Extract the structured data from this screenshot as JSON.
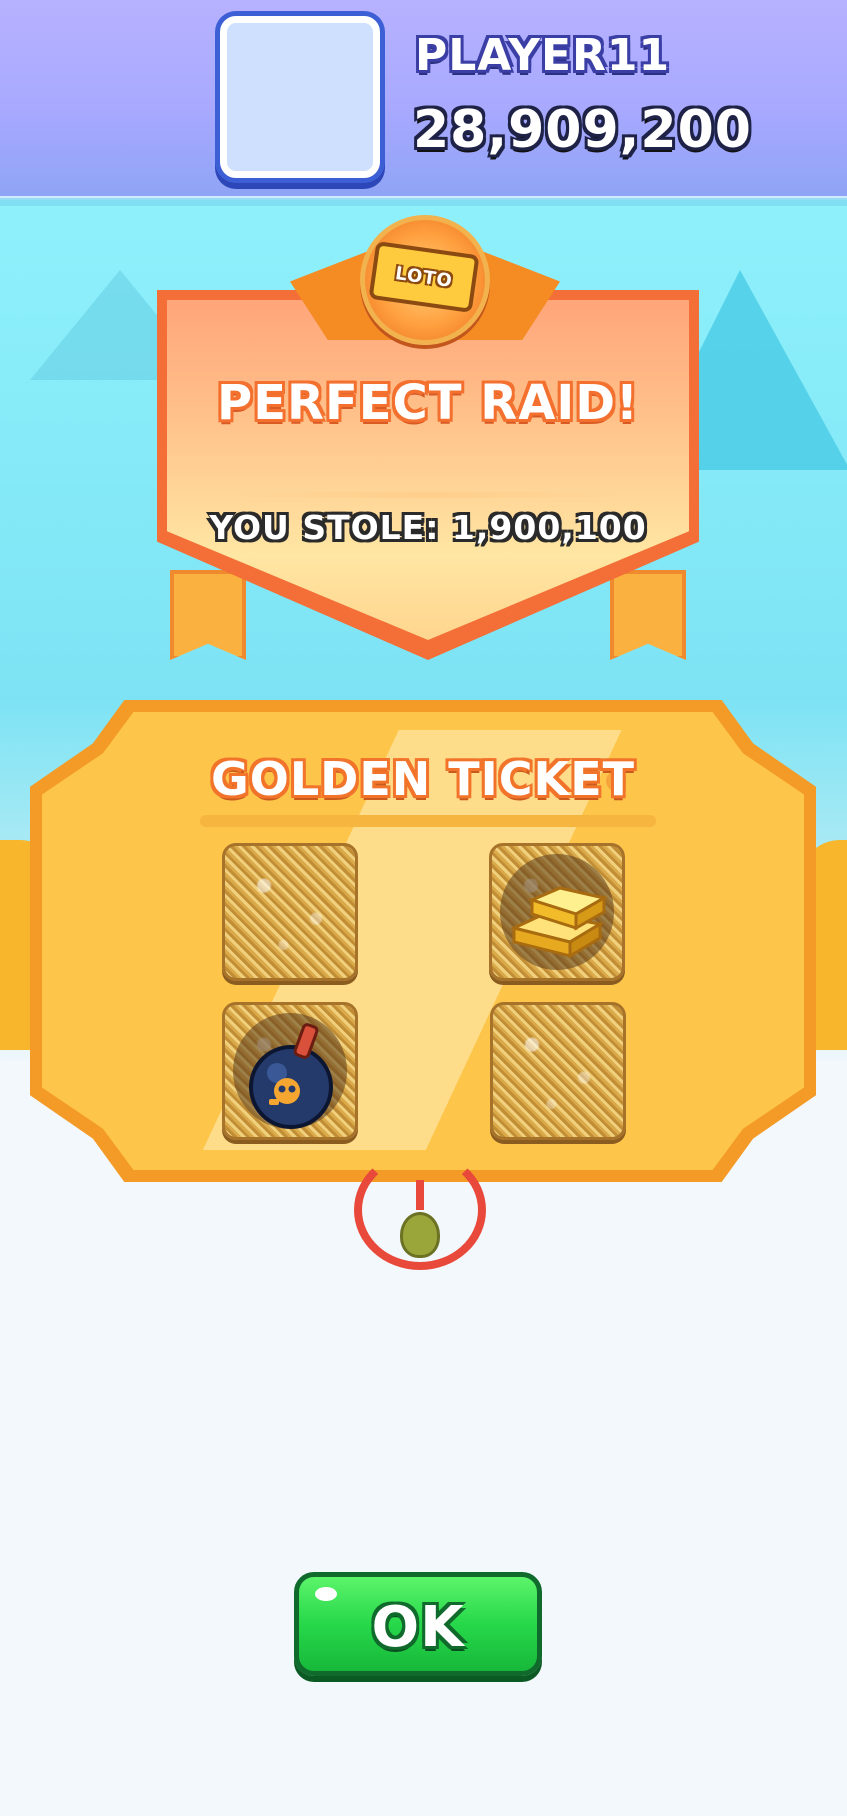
{
  "header": {
    "player_name": "PLAYER11",
    "coins": "28,909,200"
  },
  "result_banner": {
    "badge_label": "LOTO",
    "title": "PERFECT RAID!",
    "stolen_text": "YOU STOLE: 1,900,100"
  },
  "golden_ticket": {
    "title": "GOLDEN TICKET",
    "cells": [
      {
        "state": "unscratched"
      },
      {
        "state": "revealed",
        "reward": "gold-bars-icon"
      },
      {
        "state": "revealed",
        "reward": "bomb-icon"
      },
      {
        "state": "unscratched"
      }
    ]
  },
  "ok_button": {
    "label": "OK"
  },
  "colors": {
    "top_bar": "#a8a9ff",
    "banner_orange": "#f36f37",
    "ticket_gold": "#fdc54a",
    "ok_green": "#27d84a"
  }
}
